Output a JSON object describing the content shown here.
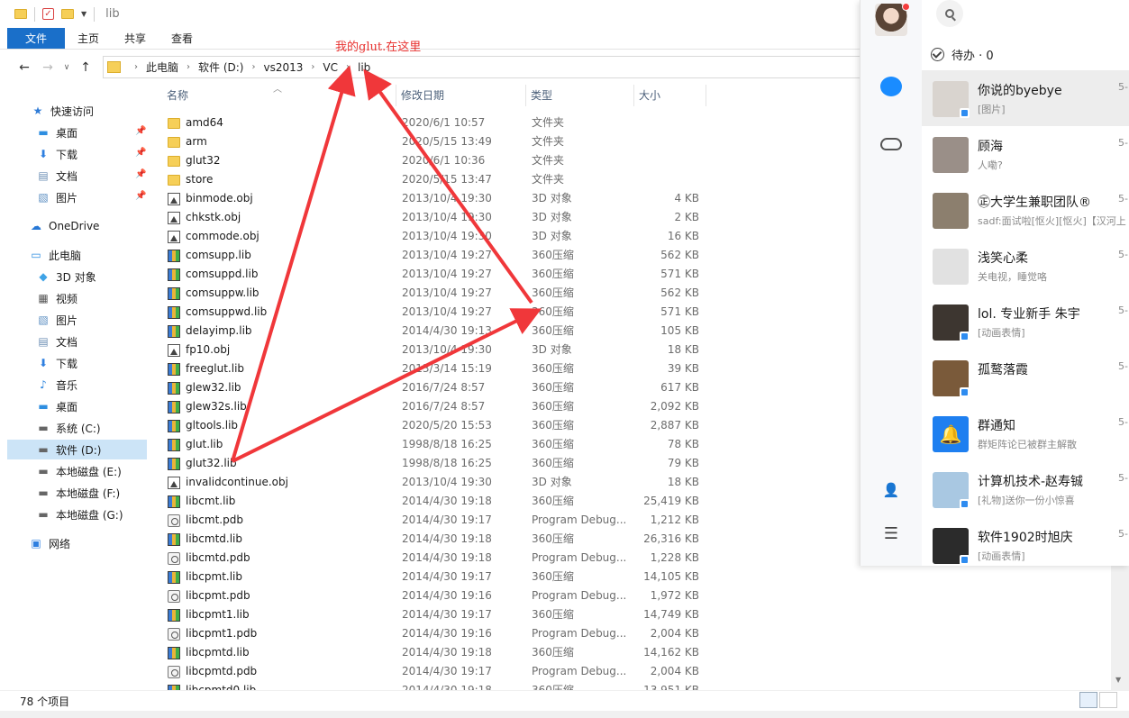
{
  "window": {
    "title": "lib"
  },
  "ribbon": {
    "tabs": [
      "文件",
      "主页",
      "共享",
      "查看"
    ]
  },
  "address": {
    "crumbs": [
      "此电脑",
      "软件 (D:)",
      "vs2013",
      "VC",
      "lib"
    ]
  },
  "annotation": {
    "text": "我的glut.在这里"
  },
  "sidebar": {
    "items": [
      {
        "label": "快速访问",
        "icon": "star-icon",
        "pinned": false
      },
      {
        "label": "桌面",
        "icon": "desktop-icon",
        "pinned": true
      },
      {
        "label": "下载",
        "icon": "download-icon",
        "pinned": true
      },
      {
        "label": "文档",
        "icon": "document-icon",
        "pinned": true
      },
      {
        "label": "图片",
        "icon": "picture-icon",
        "pinned": true
      },
      {
        "label": "OneDrive",
        "icon": "cloud-icon",
        "pinned": false
      },
      {
        "label": "此电脑",
        "icon": "computer-icon",
        "pinned": false
      },
      {
        "label": "3D 对象",
        "icon": "cube-icon",
        "pinned": false
      },
      {
        "label": "视频",
        "icon": "video-icon",
        "pinned": false
      },
      {
        "label": "图片",
        "icon": "picture-icon",
        "pinned": false
      },
      {
        "label": "文档",
        "icon": "document-icon",
        "pinned": false
      },
      {
        "label": "下载",
        "icon": "download-icon",
        "pinned": false
      },
      {
        "label": "音乐",
        "icon": "music-icon",
        "pinned": false
      },
      {
        "label": "桌面",
        "icon": "desktop-icon",
        "pinned": false
      },
      {
        "label": "系统 (C:)",
        "icon": "drive-icon",
        "pinned": false
      },
      {
        "label": "软件 (D:)",
        "icon": "drive-icon",
        "pinned": false
      },
      {
        "label": "本地磁盘 (E:)",
        "icon": "drive-icon",
        "pinned": false
      },
      {
        "label": "本地磁盘 (F:)",
        "icon": "drive-icon",
        "pinned": false
      },
      {
        "label": "本地磁盘 (G:)",
        "icon": "drive-icon",
        "pinned": false
      },
      {
        "label": "网络",
        "icon": "network-icon",
        "pinned": false
      }
    ]
  },
  "columns": {
    "name": "名称",
    "date": "修改日期",
    "type": "类型",
    "size": "大小"
  },
  "files": [
    {
      "name": "amd64",
      "date": "2020/6/1 10:57",
      "type": "文件夹",
      "size": "",
      "kind": "folder"
    },
    {
      "name": "arm",
      "date": "2020/5/15 13:49",
      "type": "文件夹",
      "size": "",
      "kind": "folder"
    },
    {
      "name": "glut32",
      "date": "2020/6/1 10:36",
      "type": "文件夹",
      "size": "",
      "kind": "folder"
    },
    {
      "name": "store",
      "date": "2020/5/15 13:47",
      "type": "文件夹",
      "size": "",
      "kind": "folder"
    },
    {
      "name": "binmode.obj",
      "date": "2013/10/4 19:30",
      "type": "3D 对象",
      "size": "4 KB",
      "kind": "obj"
    },
    {
      "name": "chkstk.obj",
      "date": "2013/10/4 19:30",
      "type": "3D 对象",
      "size": "2 KB",
      "kind": "obj"
    },
    {
      "name": "commode.obj",
      "date": "2013/10/4 19:30",
      "type": "3D 对象",
      "size": "16 KB",
      "kind": "obj"
    },
    {
      "name": "comsupp.lib",
      "date": "2013/10/4 19:27",
      "type": "360压缩",
      "size": "562 KB",
      "kind": "zip"
    },
    {
      "name": "comsuppd.lib",
      "date": "2013/10/4 19:27",
      "type": "360压缩",
      "size": "571 KB",
      "kind": "zip"
    },
    {
      "name": "comsuppw.lib",
      "date": "2013/10/4 19:27",
      "type": "360压缩",
      "size": "562 KB",
      "kind": "zip"
    },
    {
      "name": "comsuppwd.lib",
      "date": "2013/10/4 19:27",
      "type": "360压缩",
      "size": "571 KB",
      "kind": "zip"
    },
    {
      "name": "delayimp.lib",
      "date": "2014/4/30 19:13",
      "type": "360压缩",
      "size": "105 KB",
      "kind": "zip"
    },
    {
      "name": "fp10.obj",
      "date": "2013/10/4 19:30",
      "type": "3D 对象",
      "size": "18 KB",
      "kind": "obj"
    },
    {
      "name": "freeglut.lib",
      "date": "2013/3/14 15:19",
      "type": "360压缩",
      "size": "39 KB",
      "kind": "zip"
    },
    {
      "name": "glew32.lib",
      "date": "2016/7/24 8:57",
      "type": "360压缩",
      "size": "617 KB",
      "kind": "zip"
    },
    {
      "name": "glew32s.lib",
      "date": "2016/7/24 8:57",
      "type": "360压缩",
      "size": "2,092 KB",
      "kind": "zip"
    },
    {
      "name": "gltools.lib",
      "date": "2020/5/20 15:53",
      "type": "360压缩",
      "size": "2,887 KB",
      "kind": "zip"
    },
    {
      "name": "glut.lib",
      "date": "1998/8/18 16:25",
      "type": "360压缩",
      "size": "78 KB",
      "kind": "zip"
    },
    {
      "name": "glut32.lib",
      "date": "1998/8/18 16:25",
      "type": "360压缩",
      "size": "79 KB",
      "kind": "zip"
    },
    {
      "name": "invalidcontinue.obj",
      "date": "2013/10/4 19:30",
      "type": "3D 对象",
      "size": "18 KB",
      "kind": "obj"
    },
    {
      "name": "libcmt.lib",
      "date": "2014/4/30 19:18",
      "type": "360压缩",
      "size": "25,419 KB",
      "kind": "zip"
    },
    {
      "name": "libcmt.pdb",
      "date": "2014/4/30 19:17",
      "type": "Program Debug...",
      "size": "1,212 KB",
      "kind": "pdb"
    },
    {
      "name": "libcmtd.lib",
      "date": "2014/4/30 19:18",
      "type": "360压缩",
      "size": "26,316 KB",
      "kind": "zip"
    },
    {
      "name": "libcmtd.pdb",
      "date": "2014/4/30 19:18",
      "type": "Program Debug...",
      "size": "1,228 KB",
      "kind": "pdb"
    },
    {
      "name": "libcpmt.lib",
      "date": "2014/4/30 19:17",
      "type": "360压缩",
      "size": "14,105 KB",
      "kind": "zip"
    },
    {
      "name": "libcpmt.pdb",
      "date": "2014/4/30 19:16",
      "type": "Program Debug...",
      "size": "1,972 KB",
      "kind": "pdb"
    },
    {
      "name": "libcpmt1.lib",
      "date": "2014/4/30 19:17",
      "type": "360压缩",
      "size": "14,749 KB",
      "kind": "zip"
    },
    {
      "name": "libcpmt1.pdb",
      "date": "2014/4/30 19:16",
      "type": "Program Debug...",
      "size": "2,004 KB",
      "kind": "pdb"
    },
    {
      "name": "libcpmtd.lib",
      "date": "2014/4/30 19:18",
      "type": "360压缩",
      "size": "14,162 KB",
      "kind": "zip"
    },
    {
      "name": "libcpmtd.pdb",
      "date": "2014/4/30 19:17",
      "type": "Program Debug...",
      "size": "2,004 KB",
      "kind": "pdb"
    },
    {
      "name": "libcpmtd0.lib",
      "date": "2014/4/30 19:18",
      "type": "360压缩",
      "size": "13,951 KB",
      "kind": "zip"
    }
  ],
  "status": {
    "count": "78 个项目"
  },
  "chat": {
    "todo": "待办 · 0",
    "conversations": [
      {
        "name": "你说的byebye",
        "msg": "[图片]",
        "time": "5-",
        "badge": true,
        "avatar": "#d9d4cf"
      },
      {
        "name": "顾海",
        "msg": "人嘞?",
        "time": "5-",
        "badge": false,
        "avatar": "#9a8f88"
      },
      {
        "name": "㊣大学生兼职团队®",
        "msg": "sadf:面试啦[怄火][怄火]【汉河上",
        "time": "5-",
        "badge": false,
        "avatar": "#8c7f6e"
      },
      {
        "name": "浅笑心柔",
        "msg": "关电视，睡觉咯",
        "time": "5-",
        "badge": false,
        "avatar": "#e1e1e1"
      },
      {
        "name": "lol. 专业新手  朱宇",
        "msg": "[动画表情]",
        "time": "5-",
        "badge": true,
        "avatar": "#3d3630"
      },
      {
        "name": "孤鹜落霞",
        "msg": "",
        "time": "5-",
        "badge": true,
        "avatar": "#7a5a3a"
      },
      {
        "name": "群通知",
        "msg": "群矩阵论已被群主解散",
        "time": "5-",
        "badge": false,
        "avatar": "#1e7ff0"
      },
      {
        "name": "计算机技术-赵寿铖",
        "msg": "[礼物]送你一份小惊喜",
        "time": "5-",
        "badge": true,
        "avatar": "#a9c8e2"
      },
      {
        "name": "软件1902时旭庆",
        "msg": "[动画表情]",
        "time": "5-",
        "badge": true,
        "avatar": "#2b2b2b"
      }
    ]
  }
}
